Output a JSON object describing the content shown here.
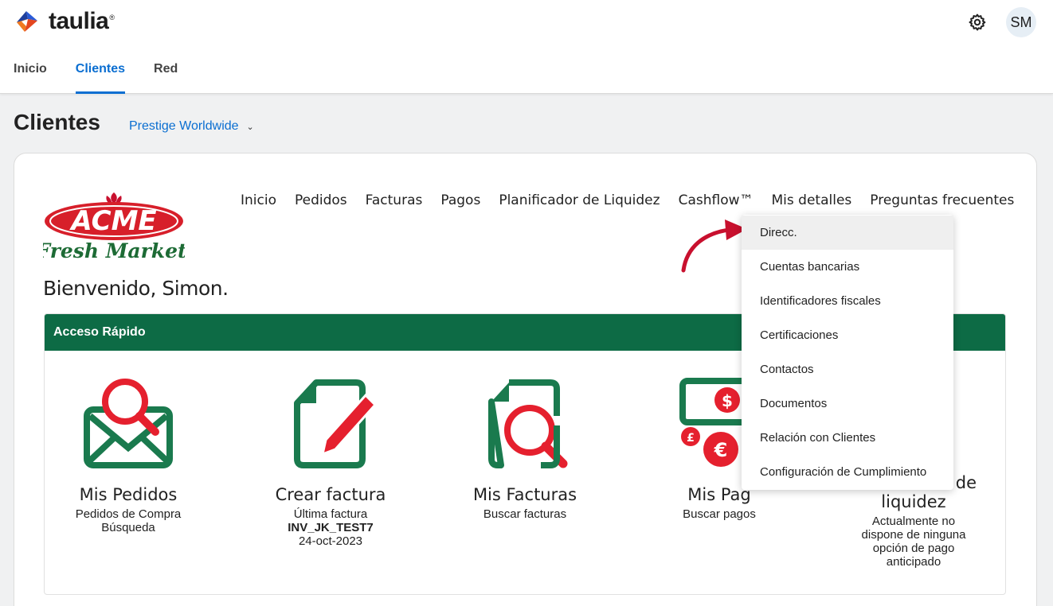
{
  "brand": {
    "name": "taulia",
    "trademark": "®"
  },
  "header": {
    "avatar_initials": "SM",
    "icons": [
      "settings-gear-icon"
    ]
  },
  "topnav": [
    "Inicio",
    "Clientes",
    "Red"
  ],
  "topnav_active": "Clientes",
  "page": {
    "title": "Clientes",
    "client_selected": "Prestige Worldwide"
  },
  "portal_nav": [
    "Inicio",
    "Pedidos",
    "Facturas",
    "Pagos",
    "Planificador de Liquidez",
    "Cashflow™",
    "Mis detalles",
    "Preguntas frecuentes"
  ],
  "logo": {
    "top": "ACME",
    "bottom": "Fresh Market"
  },
  "welcome": "Bienvenido, Simon.",
  "quick_access": {
    "title": "Acceso Rápido",
    "tiles": [
      {
        "title": "Mis Pedidos",
        "lines": [
          "Pedidos de Compra",
          "Búsqueda"
        ],
        "icon": "envelope-search-icon"
      },
      {
        "title": "Crear factura",
        "lines": [
          "Última factura",
          "INV_JK_TEST7",
          "24-oct-2023"
        ],
        "icon": "document-pencil-icon"
      },
      {
        "title": "Mis Facturas",
        "lines": [
          "Buscar facturas"
        ],
        "icon": "document-search-icon"
      },
      {
        "title": "Mis Pag",
        "lines": [
          "Buscar pagos"
        ],
        "icon": "money-currency-icon"
      },
      {
        "title_visible_end": "de",
        "title_line2": "liquidez",
        "lines": [
          "Actualmente no",
          "dispone de ninguna",
          "opción de pago",
          "anticipado"
        ]
      }
    ]
  },
  "dropdown": {
    "items": [
      "Direcc.",
      "Cuentas bancarias",
      "Identificadores fiscales",
      "Certificaciones",
      "Contactos",
      "Documentos",
      "Relación con Clientes",
      "Configuración de Cumplimiento"
    ],
    "hovered": "Direcc."
  },
  "colors": {
    "accent": "#0a6ed1",
    "green": "#0d6b45",
    "red": "#e5202e"
  }
}
